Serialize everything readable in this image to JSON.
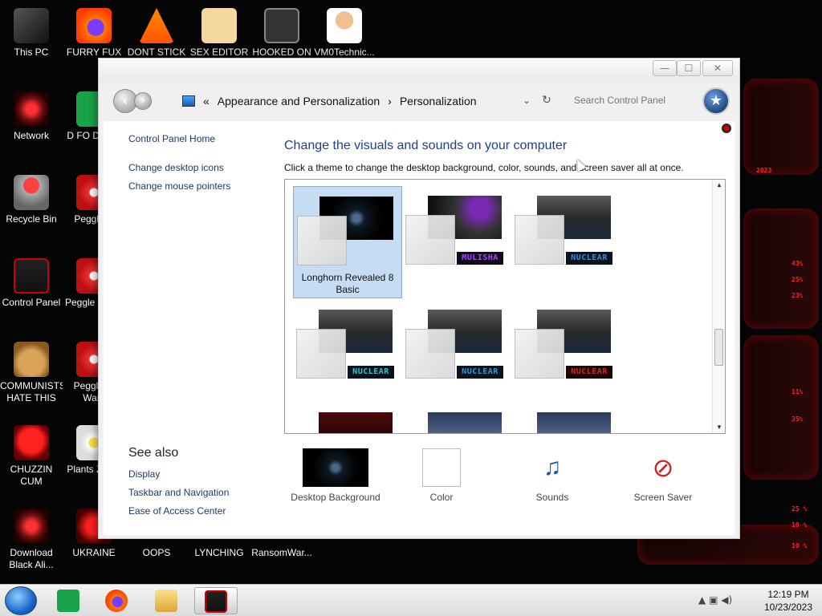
{
  "desktop": {
    "icons": [
      {
        "label": "This PC",
        "icon": "computer-icon"
      },
      {
        "label": "FURRY FUX",
        "icon": "firefox-icon"
      },
      {
        "label": "DONT STICK",
        "icon": "vlc-icon"
      },
      {
        "label": "SEX EDITOR",
        "icon": "hxd-icon"
      },
      {
        "label": "HOOKED ON",
        "icon": "app-icon"
      },
      {
        "label": "VM0Technic...",
        "icon": "doctor-icon"
      },
      {
        "label": "Network",
        "icon": "alien-network-icon"
      },
      {
        "label": "D FO DUMB",
        "icon": "green-app-icon"
      },
      {
        "label": "Recycle Bin",
        "icon": "recycle-bin-icon"
      },
      {
        "label": "Peggle D",
        "icon": "peggle-icon"
      },
      {
        "label": "Control Panel",
        "icon": "control-panel-icon"
      },
      {
        "label": "Peggle I Delu",
        "icon": "peggle-icon"
      },
      {
        "label": "COMMUNISTS HATE THIS G...",
        "icon": "money-bag-icon"
      },
      {
        "label": "Peggle of Warc",
        "icon": "peggle-icon"
      },
      {
        "label": "CHUZZIN CUM",
        "icon": "chuzzle-icon"
      },
      {
        "label": "Plants Zomb",
        "icon": "flower-icon"
      },
      {
        "label": "Download Black Ali...",
        "icon": "alien-icon"
      },
      {
        "label": "UKRAINE",
        "icon": "red-app-icon"
      },
      {
        "label": "OOPS",
        "icon": "app-icon"
      },
      {
        "label": "LYNCHING",
        "icon": "app-icon"
      },
      {
        "label": "RansomWar...",
        "icon": "app-icon"
      }
    ],
    "hud_readouts": [
      "2023",
      "43%",
      "25%",
      "23%",
      "11%",
      "35%",
      "25 %",
      "10 %",
      "10 %"
    ]
  },
  "window": {
    "controls": {
      "minimize": "—",
      "maximize": "☐",
      "close": "✕"
    },
    "breadcrumb": {
      "overflow": "«",
      "segments": [
        "Appearance and Personalization",
        "Personalization"
      ],
      "separator": "›"
    },
    "search_placeholder": "Search Control Panel",
    "sidebar": {
      "home": "Control Panel Home",
      "links": [
        "Change desktop icons",
        "Change mouse pointers"
      ],
      "see_also_title": "See also",
      "see_also": [
        "Display",
        "Taskbar and Navigation",
        "Ease of Access Center"
      ]
    },
    "main": {
      "heading": "Change the visuals and sounds on your computer",
      "subtext": "Click a theme to change the desktop background, color, sounds, and screen saver all at once.",
      "themes": [
        {
          "name": "Longhorn Revealed 8 Basic",
          "selected": true,
          "badge": ""
        },
        {
          "name": "",
          "selected": false,
          "badge": "MULISHA"
        },
        {
          "name": "",
          "selected": false,
          "badge": "NUCLEAR"
        },
        {
          "name": "",
          "selected": false,
          "badge": "NUCLEAR"
        },
        {
          "name": "",
          "selected": false,
          "badge": "NUCLEAR"
        },
        {
          "name": "",
          "selected": false,
          "badge": "NUCLEAR"
        }
      ],
      "bottom": [
        {
          "label": "Desktop Background",
          "icon": "wallpaper-icon"
        },
        {
          "label": "Color",
          "icon": "color-swatch-icon"
        },
        {
          "label": "Sounds",
          "icon": "sounds-icon"
        },
        {
          "label": "Screen Saver",
          "icon": "screen-saver-icon"
        }
      ]
    }
  },
  "taskbar": {
    "apps": [
      "start-orb",
      "green-app",
      "firefox",
      "file-explorer",
      "control-panel"
    ],
    "clock_time": "12:19 PM",
    "clock_date": "10/23/2023"
  },
  "colors": {
    "accent_heading": "#1e3f8a",
    "link": "#1c3a6a",
    "selected_theme_bg": "#c6dcf2",
    "hud_red": "#ff2222"
  }
}
